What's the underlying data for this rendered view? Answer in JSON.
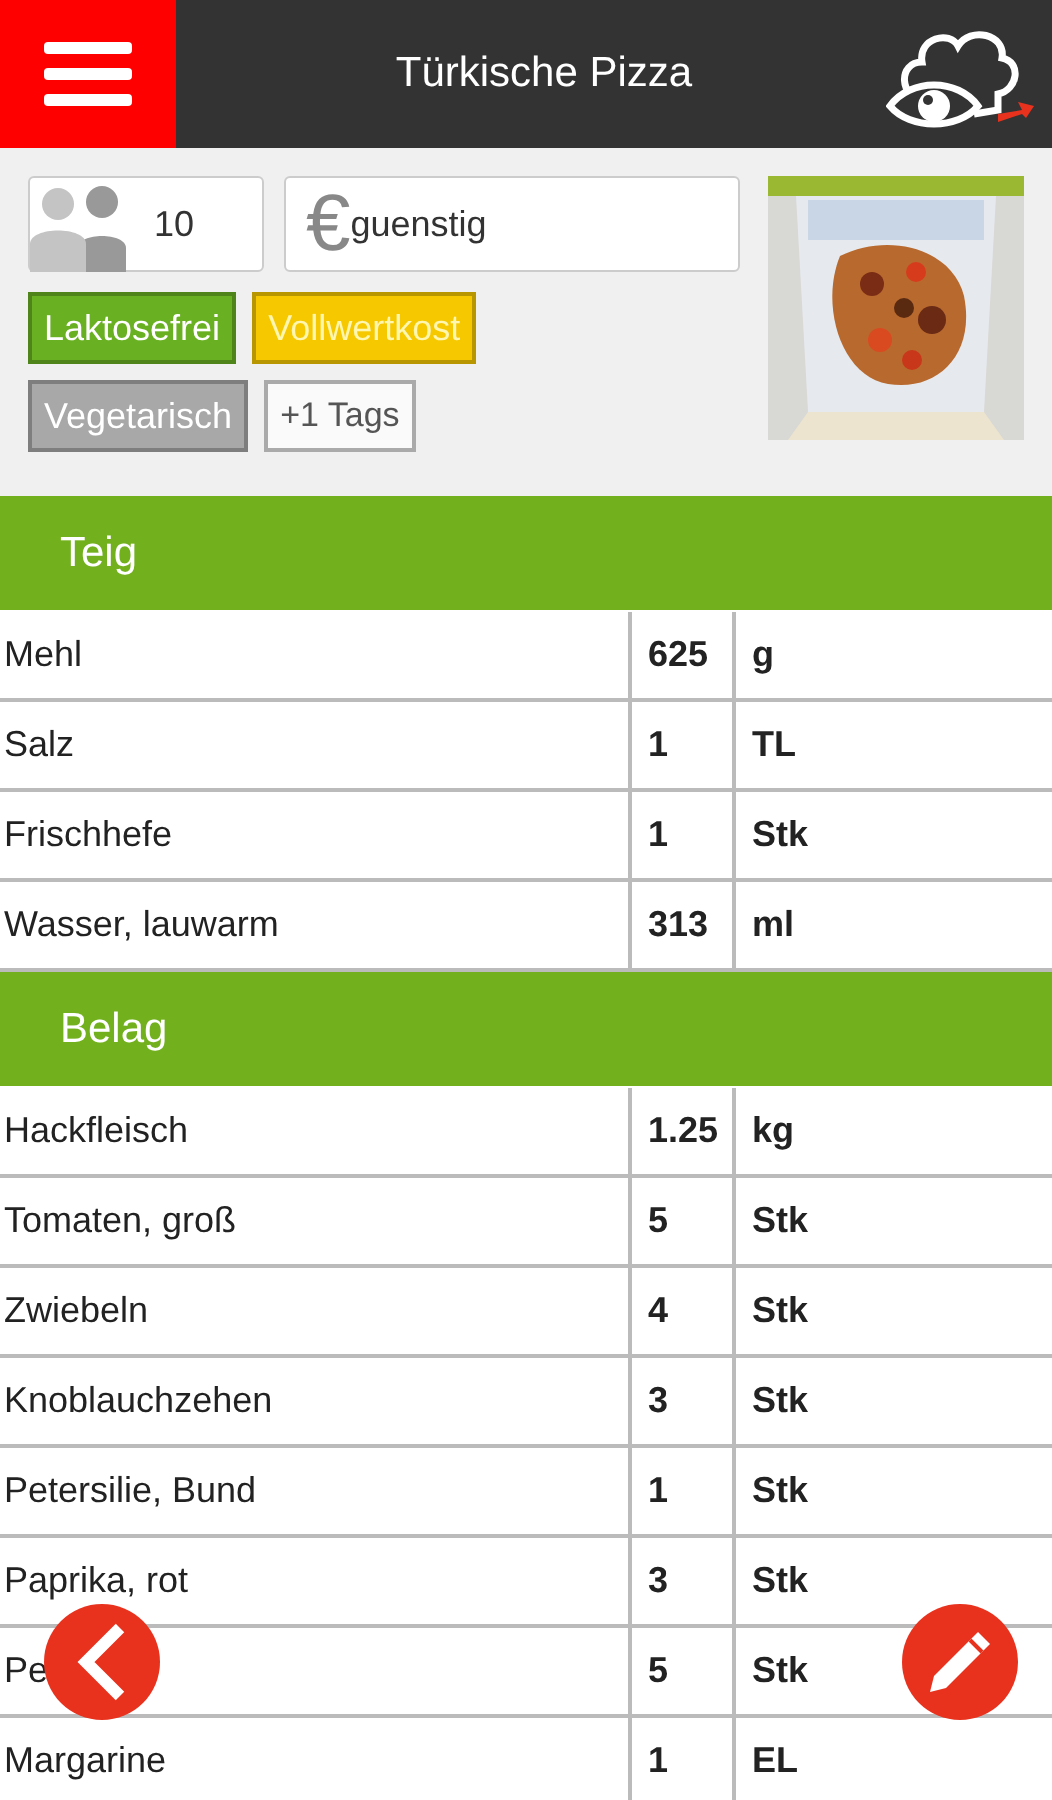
{
  "header": {
    "title": "Türkische Pizza"
  },
  "servings": {
    "value": "10"
  },
  "price": {
    "symbol": "€",
    "value": "guenstig"
  },
  "tags": [
    {
      "label": "Laktosefrei",
      "kind": "tag",
      "color": "#6ab023"
    },
    {
      "label": "Vollwertkost",
      "kind": "tag",
      "color": "#f5c800"
    },
    {
      "label": "Vegetarisch",
      "kind": "tag",
      "color": "#a8a8a8"
    },
    {
      "label": "+1 Tags",
      "kind": "more"
    }
  ],
  "sections": [
    {
      "title": "Teig",
      "rows": [
        {
          "name": "Mehl",
          "amount": "625",
          "unit": "g"
        },
        {
          "name": "Salz",
          "amount": "1",
          "unit": "TL"
        },
        {
          "name": "Frischhefe",
          "amount": "1",
          "unit": "Stk"
        },
        {
          "name": "Wasser, lauwarm",
          "amount": "313",
          "unit": "ml"
        }
      ]
    },
    {
      "title": "Belag",
      "rows": [
        {
          "name": "Hackfleisch",
          "amount": "1.25",
          "unit": "kg"
        },
        {
          "name": "Tomaten, groß",
          "amount": "5",
          "unit": "Stk"
        },
        {
          "name": "Zwiebeln",
          "amount": "4",
          "unit": "Stk"
        },
        {
          "name": "Knoblauchzehen",
          "amount": "3",
          "unit": "Stk"
        },
        {
          "name": "Petersilie, Bund",
          "amount": "1",
          "unit": "Stk"
        },
        {
          "name": "Paprika, rot",
          "amount": "3",
          "unit": "Stk"
        },
        {
          "name": "Pe",
          "amount": "5",
          "unit": "Stk"
        },
        {
          "name": "Margarine",
          "amount": "1",
          "unit": "EL"
        }
      ]
    }
  ]
}
